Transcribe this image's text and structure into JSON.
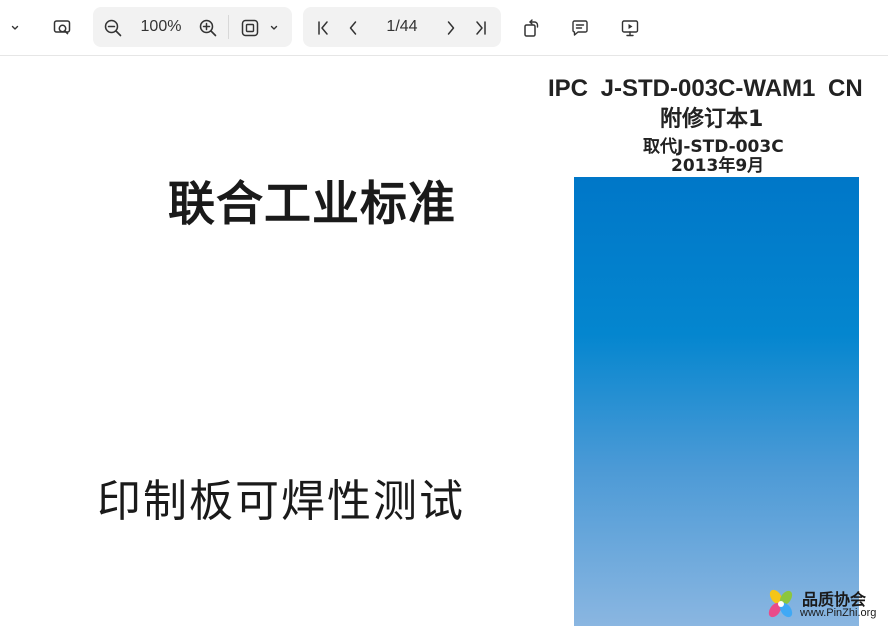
{
  "toolbar": {
    "icons": {
      "menu_chevron": "chevron-down-icon",
      "search": "search-in-document-icon",
      "zoom_out": "zoom-out-icon",
      "zoom_in": "zoom-in-icon",
      "fit_page": "fit-page-icon",
      "fit_chevron": "chevron-down-icon",
      "first_page": "first-page-icon",
      "prev_page": "previous-page-icon",
      "next_page": "next-page-icon",
      "last_page": "last-page-icon",
      "rotate": "rotate-icon",
      "comment": "comment-icon",
      "present": "presentation-icon"
    },
    "zoom_level": "100%",
    "page_indicator": "1/44"
  },
  "document": {
    "standard_id": "IPC J-STD-003C-WAM1 CN",
    "amendment": "附修订本1",
    "supersedes": "取代J-STD-003C",
    "date": "2013年9月",
    "joint_standard_title": "联合工业标准",
    "title": "印制板可焊性测试",
    "cover_colors": [
      "#0077c8",
      "#0486cf",
      "#4c9ad6",
      "#8ab6e1"
    ]
  },
  "watermark": {
    "name_cn": "品质协会",
    "url": "www.PinZhi.org"
  }
}
